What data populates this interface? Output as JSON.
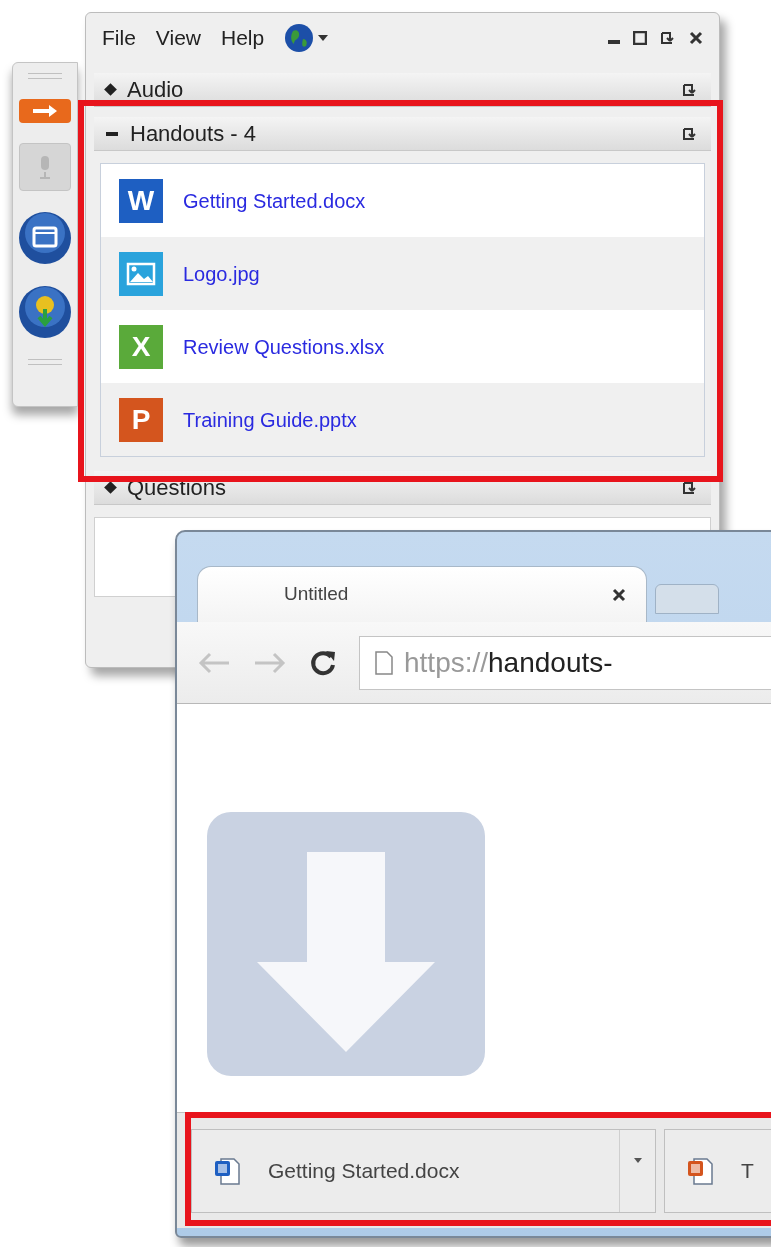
{
  "panel": {
    "menu": [
      "File",
      "View",
      "Help"
    ],
    "sections": [
      {
        "title": "Audio",
        "expanded": false
      },
      {
        "title": "Handouts - 4",
        "expanded": true,
        "files": [
          {
            "name": "Getting Started.docx",
            "kind": "word",
            "letter": "W"
          },
          {
            "name": "Logo.jpg",
            "kind": "image"
          },
          {
            "name": "Review Questions.xlsx",
            "kind": "excel",
            "letter": "X"
          },
          {
            "name": "Training Guide.pptx",
            "kind": "powerpoint",
            "letter": "P"
          }
        ]
      },
      {
        "title": "Questions",
        "expanded": false
      }
    ]
  },
  "browser": {
    "tab": {
      "title": "Untitled"
    },
    "address": {
      "scheme": "https://",
      "host": "handouts-"
    },
    "downloads": [
      {
        "name": "Getting Started.docx",
        "kind": "word"
      },
      {
        "name": "T",
        "kind": "powerpoint"
      }
    ]
  }
}
